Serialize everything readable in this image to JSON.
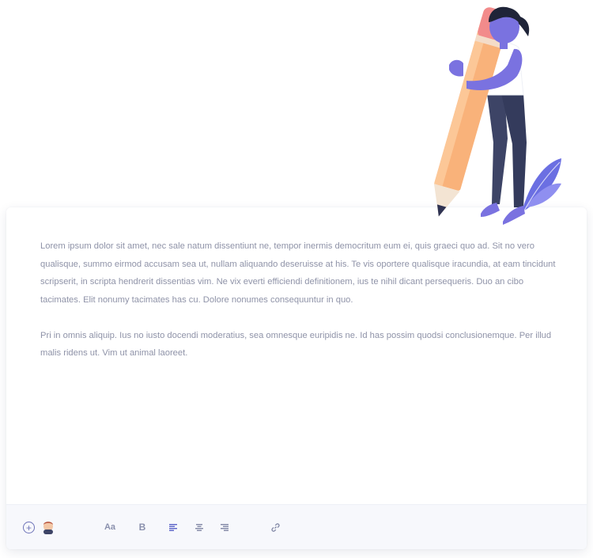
{
  "editor": {
    "paragraphs": [
      "Lorem ipsum dolor sit amet, nec sale natum dissentiunt ne, tempor inermis democritum eum ei, quis graeci quo ad. Sit no vero qualisque, summo eirmod accusam sea ut, nullam aliquando deseruisse at his. Te vis oportere qualisque iracundia, at eam tincidunt scripserit, in scripta hendrerit dissentias vim. Ne vix everti efficiendi definitionem, ius te nihil dicant persequeris. Duo an cibo tacimates. Elit nonumy tacimates has cu. Dolore nonumes consequuntur in quo.",
      "Pri in omnis aliquip. Ius no iusto docendi moderatius, sea omnesque euripidis ne. Id has possim quodsi conclusionemque. Per illud malis ridens ut. Vim ut animal laoreet."
    ]
  },
  "toolbar": {
    "add_label": "+",
    "font_size_label": "Aa",
    "bold_label": "B"
  },
  "icons": {
    "add": "plus-circle-icon",
    "avatar": "user-avatar-icon",
    "font_size": "font-size-icon",
    "bold": "bold-icon",
    "align_left": "align-left-icon",
    "align_center": "align-center-icon",
    "align_right": "align-right-icon",
    "link": "link-icon"
  },
  "colors": {
    "text": "#8f93a8",
    "toolbar_bg": "#f7f8fc",
    "accent": "#6d73b8",
    "pencil": "#f9b27a",
    "figure_purple": "#7a72e0",
    "figure_pants": "#3d4466"
  }
}
